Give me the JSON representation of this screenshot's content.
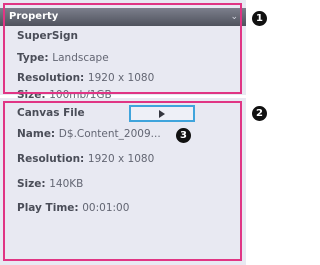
{
  "property": {
    "header": "Property",
    "collapse_icon": "chevron-down-icon",
    "name": "SuperSign",
    "type_key": "Type:",
    "type_value": "Landscape",
    "resolution_key": "Resolution:",
    "resolution_value": "1920 x 1080",
    "size_key": "Size:",
    "size_value": "100mb/1GB"
  },
  "canvas": {
    "title": "Canvas File",
    "name_key": "Name:",
    "name_value": "D$.Content_2009",
    "name_ellipsis": "...",
    "resolution_key": "Resolution:",
    "resolution_value": "1920 x 1080",
    "size_key": "Size:",
    "size_value": "140KB",
    "playtime_key": "Play Time:",
    "playtime_value": "00:01:00"
  },
  "callouts": [
    "1",
    "2",
    "3"
  ],
  "colors": {
    "highlight_border": "#e03584",
    "button_border": "#3fa4dc"
  }
}
